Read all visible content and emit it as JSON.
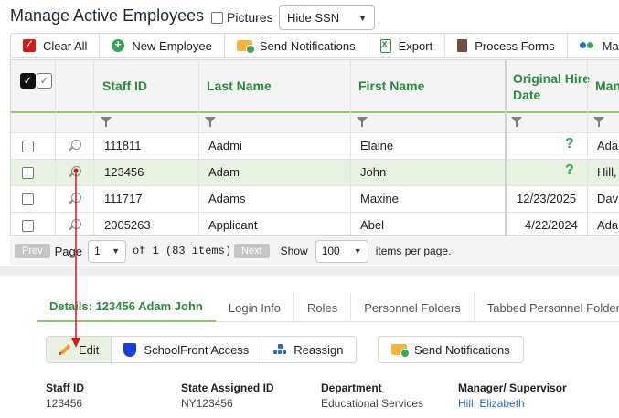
{
  "header": {
    "title": "Manage Active Employees",
    "pictures_label": "Pictures",
    "ssn_select_value": "Hide SSN"
  },
  "toolbar": {
    "clear_all": "Clear All",
    "new_employee": "New Employee",
    "send_notifications": "Send Notifications",
    "export": "Export",
    "process_forms": "Process Forms",
    "manage_partial": "Ma"
  },
  "grid": {
    "columns": {
      "staff_id": "Staff ID",
      "last_name": "Last Name",
      "first_name": "First Name",
      "hire_date_line1": "Original Hire",
      "hire_date_line2": "Date",
      "manager_partial": "Man"
    },
    "rows": [
      {
        "staff_id": "111811",
        "last_name": "Aadmi",
        "first_name": "Elaine",
        "hire_date": "?",
        "manager": "Adar"
      },
      {
        "staff_id": "123456",
        "last_name": "Adam",
        "first_name": "John",
        "hire_date": "?",
        "manager": "Hill, I"
      },
      {
        "staff_id": "111717",
        "last_name": "Adams",
        "first_name": "Maxine",
        "hire_date": "12/23/2025",
        "manager": "Davis"
      },
      {
        "staff_id": "2005263",
        "last_name": "Applicant",
        "first_name": "Abel",
        "hire_date": "4/22/2024",
        "manager": "Adar"
      }
    ]
  },
  "pager": {
    "prev": "Prev",
    "page_label": "Page",
    "page_value": "1",
    "of_text": "of 1 (83 items)",
    "next": "Next",
    "show_label": "Show",
    "show_value": "100",
    "per_page_text": "items per page."
  },
  "details": {
    "tabs": [
      "Details: 123456 Adam John",
      "Login Info",
      "Roles",
      "Personnel Folders",
      "Tabbed Personnel Folders"
    ],
    "actions": {
      "edit": "Edit",
      "schoolfront_access": "SchoolFront Access",
      "reassign": "Reassign",
      "send_notifications": "Send Notifications"
    },
    "fields": [
      {
        "label": "Staff ID",
        "value": "123456"
      },
      {
        "label": "State Assigned ID",
        "value": "NY123456"
      },
      {
        "label": "Department",
        "value": "Educational Services"
      },
      {
        "label": "Manager/ Supervisor",
        "value": "Hill, Elizabeth"
      }
    ]
  },
  "colors": {
    "accent_green": "#2a8a3d",
    "highlight_row": "#e8f2e1",
    "annotation_arrow": "#d7191c",
    "link_blue": "#2d6db5"
  }
}
